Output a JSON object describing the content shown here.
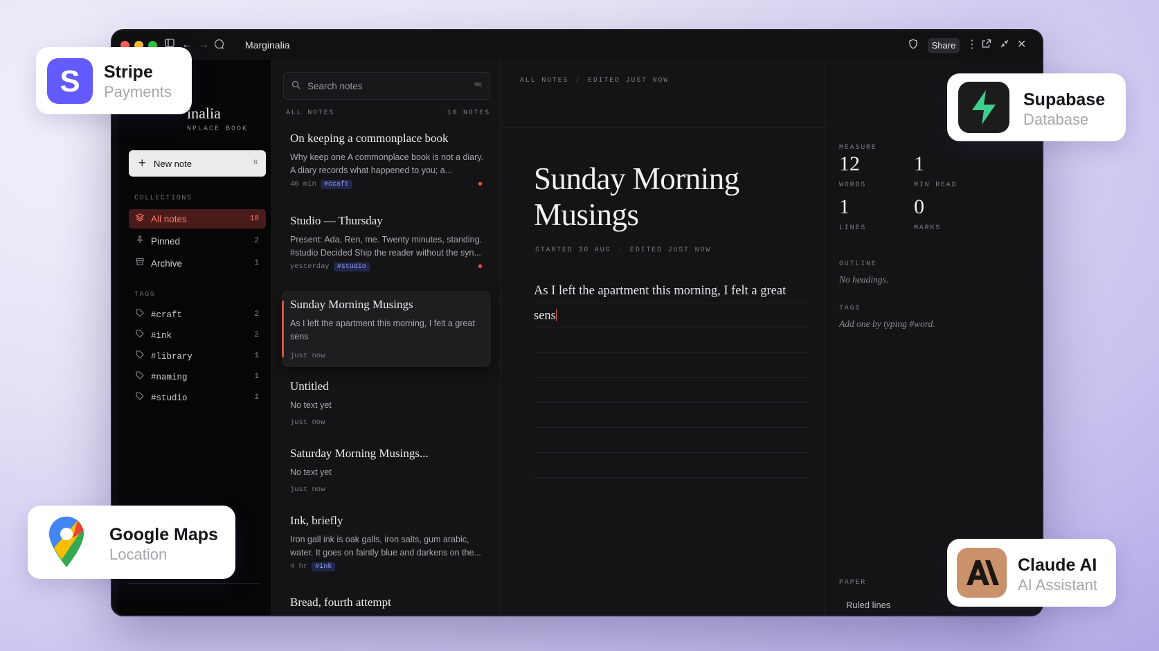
{
  "window": {
    "title": "Marginalia",
    "share_label": "Share"
  },
  "brand": {
    "title_visible": "inalia",
    "subtitle_visible": "NPLACE BOOK"
  },
  "sidebar": {
    "new_note": {
      "label": "New note",
      "shortcut": "N"
    },
    "collections_heading": "COLLECTIONS",
    "collections": [
      {
        "label": "All notes",
        "count": "10",
        "icon": "layers-icon"
      },
      {
        "label": "Pinned",
        "count": "2",
        "icon": "pin-icon"
      },
      {
        "label": "Archive",
        "count": "1",
        "icon": "archive-icon"
      }
    ],
    "tags_heading": "TAGS",
    "tags": [
      {
        "label": "#craft",
        "count": "2"
      },
      {
        "label": "#ink",
        "count": "2"
      },
      {
        "label": "#library",
        "count": "1"
      },
      {
        "label": "#naming",
        "count": "1"
      },
      {
        "label": "#studio",
        "count": "1"
      }
    ]
  },
  "note_list": {
    "search_placeholder": "Search notes",
    "search_shortcut": "⌘K",
    "heading": "ALL NOTES",
    "count_label": "10 NOTES",
    "notes": [
      {
        "title": "On keeping a commonplace book",
        "body": "Why keep one A commonplace book is not a diary. A diary records what happened to you; a...",
        "time": "40 min",
        "tag": "#ccaft",
        "pinned": true
      },
      {
        "title": "Studio — Thursday",
        "body": "Present: Ada, Ren, me. Twenty minutes, standing. #studio Decided Ship the reader without the syn...",
        "time": "yesterday",
        "tag": "#studio",
        "pinned": true
      },
      {
        "title": "Sunday Morning Musings",
        "body": "As I left the apartment this morning, I felt a great sens",
        "time": "just now",
        "tag": ""
      },
      {
        "title": "Untitled",
        "body": "No text yet",
        "time": "just now",
        "tag": ""
      },
      {
        "title": "Saturday Morning Musings...",
        "body": "No text yet",
        "time": "just now",
        "tag": ""
      },
      {
        "title": "Ink, briefly",
        "body": "Iron gall ink is oak galls, iron salts, gum arabic, water. It goes on faintly blue and darkens on the...",
        "time": "4 hr",
        "tag": "#ink"
      },
      {
        "title": "Bread, fourth attempt",
        "body": "",
        "time": "",
        "tag": ""
      }
    ]
  },
  "editor": {
    "crumb_root": "ALL NOTES",
    "crumb_status": "EDITED JUST NOW",
    "title": "Sunday Morning Musings",
    "meta_started": "STARTED 30 AUG",
    "meta_edited": "EDITED JUST NOW",
    "body": "As I left the apartment this morning, I felt a great sens"
  },
  "info_panel": {
    "measure_heading": "MEASURE",
    "words_value": "12",
    "words_label": "WORDS",
    "minread_value": "1",
    "minread_label": "MIN READ",
    "lines_value": "1",
    "lines_label": "LINES",
    "marks_value": "0",
    "marks_label": "MARKS",
    "outline_heading": "OUTLINE",
    "outline_empty": "No headings.",
    "tags_heading": "TAGS",
    "tags_hint": "Add one by typing #word.",
    "paper_heading": "PAPER",
    "paper_value": "Ruled lines"
  },
  "badges": {
    "stripe": {
      "name": "Stripe",
      "sub": "Payments",
      "color": "#635bff"
    },
    "supabase": {
      "name": "Supabase",
      "sub": "Database",
      "color": "#3ecf8e"
    },
    "maps": {
      "name": "Google Maps",
      "sub": "Location"
    },
    "claude": {
      "name": "Claude AI",
      "sub": "AI Assistant",
      "color": "#c9926b"
    }
  },
  "colors": {
    "accent": "#e0513c",
    "tag_bg": "#22264a",
    "tag_fg": "#8f9bf0"
  }
}
